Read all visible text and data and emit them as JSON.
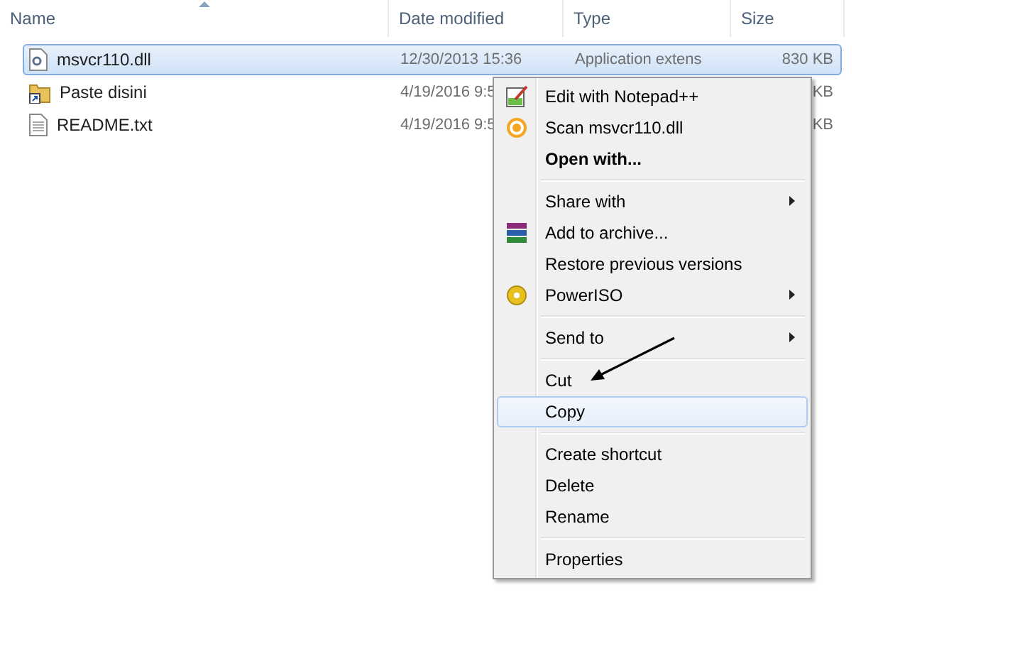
{
  "columns": [
    {
      "label": "Name",
      "sorted": true
    },
    {
      "label": "Date modified",
      "sorted": false
    },
    {
      "label": "Type",
      "sorted": false
    },
    {
      "label": "Size",
      "sorted": false
    }
  ],
  "files": [
    {
      "name": "msvcr110.dll",
      "kind": "library",
      "date": "12/30/2013 15:36",
      "type": "Application extens",
      "size": "830 KB",
      "selected": true
    },
    {
      "name": "Paste disini",
      "kind": "shortcut",
      "date": "4/19/2016 9:5",
      "size": "KB",
      "selected": false
    },
    {
      "name": "README.txt",
      "kind": "document",
      "date": "4/19/2016 9:5",
      "size": "KB",
      "selected": false
    }
  ],
  "context_menu": [
    {
      "kind": "item",
      "label": "Edit with Notepad++",
      "bold": false,
      "submenu": false,
      "selected": false
    },
    {
      "kind": "item",
      "label": "Scan msvcr110.dll",
      "bold": false,
      "submenu": false,
      "selected": false
    },
    {
      "kind": "item",
      "label": "Open with...",
      "bold": true,
      "submenu": false,
      "selected": false
    },
    {
      "kind": "separator"
    },
    {
      "kind": "item",
      "label": "Share with",
      "bold": false,
      "submenu": true,
      "selected": false
    },
    {
      "kind": "item",
      "label": "Add to archive...",
      "bold": false,
      "submenu": false,
      "selected": false
    },
    {
      "kind": "item",
      "label": "Restore previous versions",
      "bold": false,
      "submenu": false,
      "selected": false
    },
    {
      "kind": "item",
      "label": "PowerISO",
      "bold": false,
      "submenu": true,
      "selected": false
    },
    {
      "kind": "separator"
    },
    {
      "kind": "item",
      "label": "Send to",
      "bold": false,
      "submenu": true,
      "selected": false
    },
    {
      "kind": "separator"
    },
    {
      "kind": "item",
      "label": "Cut",
      "bold": false,
      "submenu": false,
      "selected": false
    },
    {
      "kind": "item",
      "label": "Copy",
      "bold": false,
      "submenu": false,
      "selected": true
    },
    {
      "kind": "separator"
    },
    {
      "kind": "item",
      "label": "Create shortcut",
      "bold": false,
      "submenu": false,
      "selected": false
    },
    {
      "kind": "item",
      "label": "Delete",
      "bold": false,
      "submenu": false,
      "selected": false
    },
    {
      "kind": "item",
      "label": "Rename",
      "bold": false,
      "submenu": false,
      "selected": false
    },
    {
      "kind": "separator"
    },
    {
      "kind": "item",
      "label": "Properties",
      "bold": false,
      "submenu": false,
      "selected": false
    }
  ]
}
